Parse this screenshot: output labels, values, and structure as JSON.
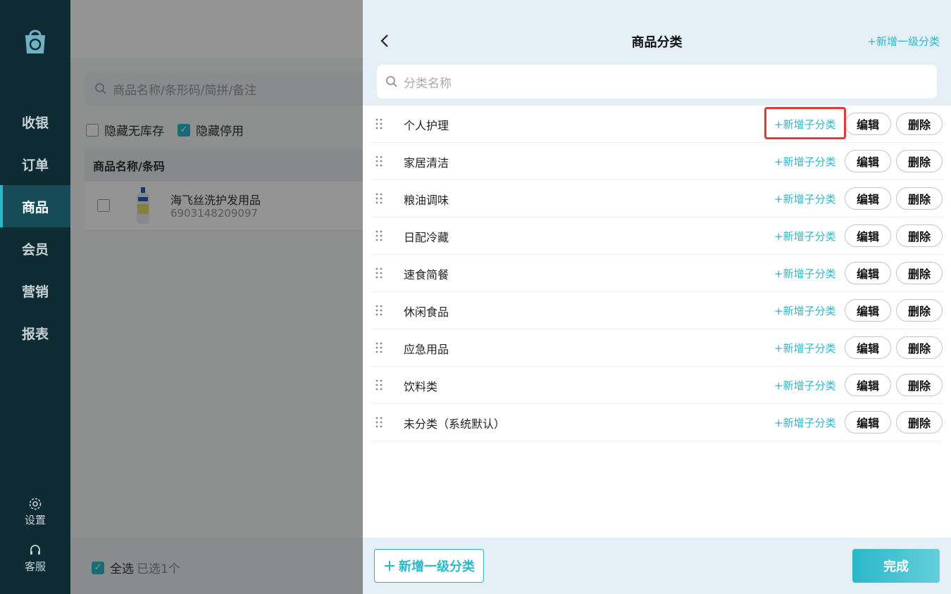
{
  "sidebar": {
    "nav": [
      {
        "label": "收银",
        "active": false
      },
      {
        "label": "订单",
        "active": false
      },
      {
        "label": "商品",
        "active": true
      },
      {
        "label": "会员",
        "active": false
      },
      {
        "label": "营销",
        "active": false
      },
      {
        "label": "报表",
        "active": false
      }
    ],
    "settings_label": "设置",
    "service_label": "客服",
    "settings_icon": "gear-icon",
    "service_icon": "headset-icon"
  },
  "background": {
    "search_placeholder": "商品名称/条形码/简拼/备注",
    "hide_no_stock": "隐藏无库存",
    "hide_disabled": "隐藏停用",
    "column_header": "商品名称/条码",
    "product": {
      "name": "海飞丝洗护发用品",
      "code": "6903148209097"
    },
    "select_all": "全选",
    "selected_count": "已选1个"
  },
  "drawer": {
    "title": "商品分类",
    "top_add": "+新增一级分类",
    "search_placeholder": "分类名称",
    "add_sub_label": "+新增子分类",
    "edit_label": "编辑",
    "delete_label": "删除",
    "categories": [
      {
        "name": "个人护理"
      },
      {
        "name": "家居清洁"
      },
      {
        "name": "粮油调味"
      },
      {
        "name": "日配冷藏"
      },
      {
        "name": "速食简餐"
      },
      {
        "name": "休闲食品"
      },
      {
        "name": "应急用品"
      },
      {
        "name": "饮料类"
      },
      {
        "name": "未分类（系统默认）"
      }
    ],
    "bottom_add": "新增一级分类",
    "done": "完成"
  },
  "colors": {
    "accent": "#2bb8c9",
    "sidebar": "#0e2a33",
    "highlight": "#e5393a"
  }
}
